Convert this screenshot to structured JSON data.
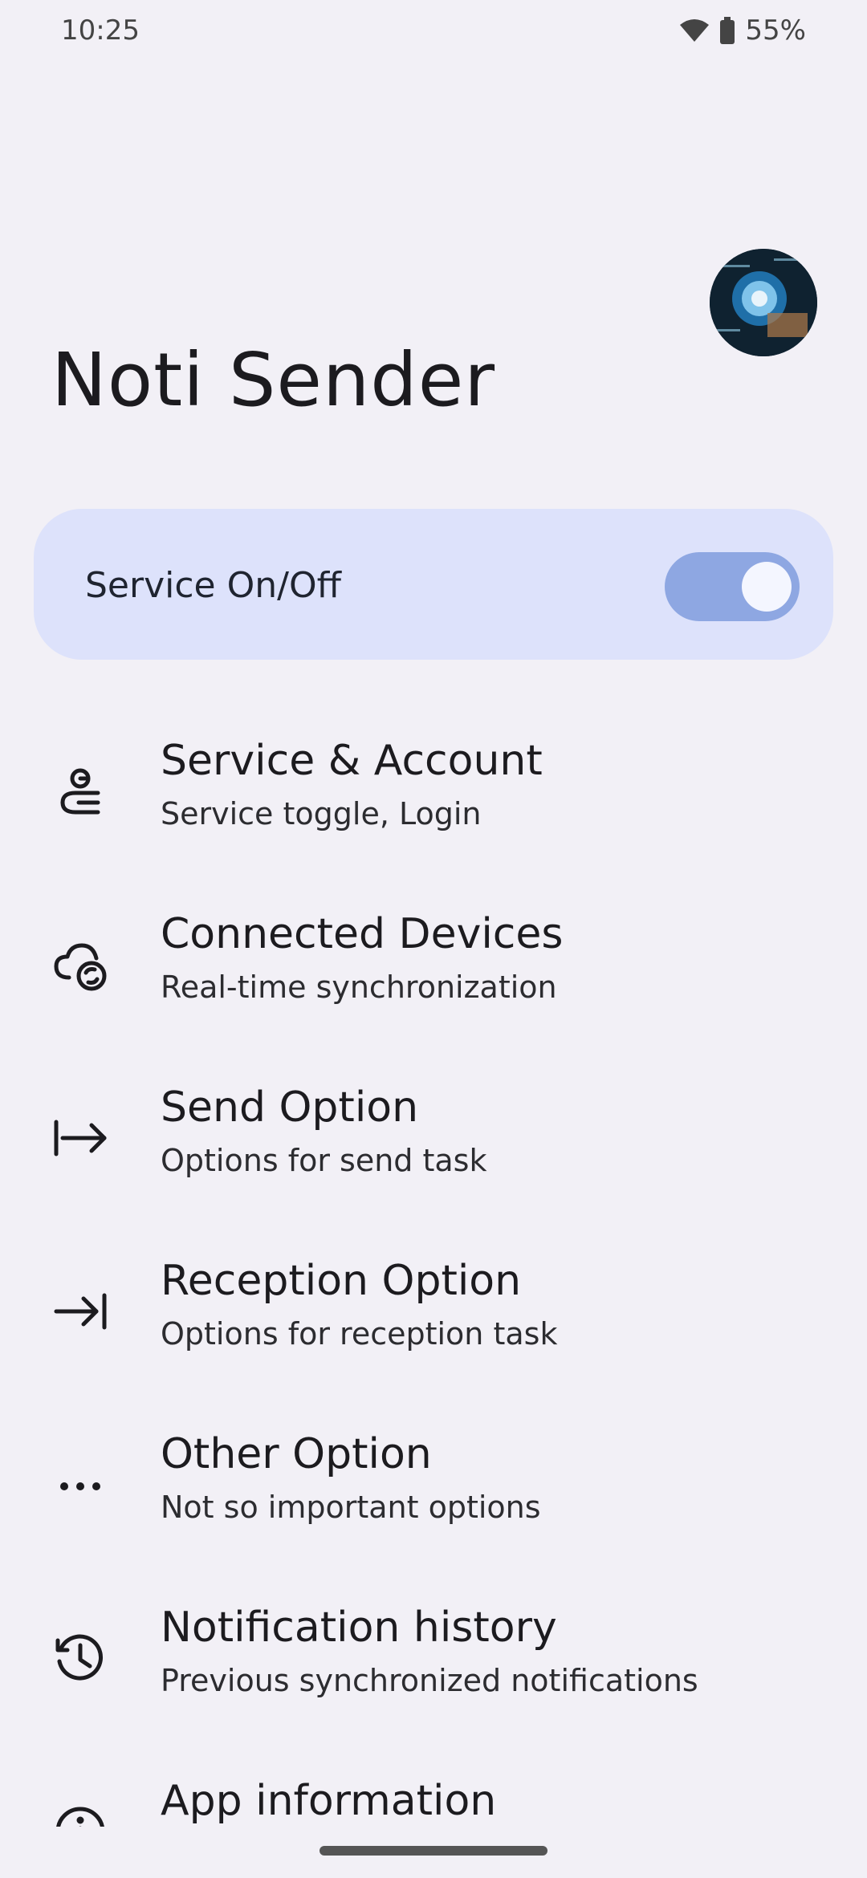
{
  "status": {
    "time": "10:25",
    "battery": "55%",
    "battery_level": 0.55
  },
  "header": {
    "title": "Noti Sender"
  },
  "service_card": {
    "label": "Service On/Off",
    "enabled": true
  },
  "menu": [
    {
      "icon": "service-account-icon",
      "title": "Service & Account",
      "subtitle": "Service toggle, Login"
    },
    {
      "icon": "cloud-sync-icon",
      "title": "Connected Devices",
      "subtitle": "Real-time synchronization"
    },
    {
      "icon": "send-arrow-icon",
      "title": "Send Option",
      "subtitle": "Options for send task"
    },
    {
      "icon": "receive-arrow-icon",
      "title": "Reception Option",
      "subtitle": "Options for reception task"
    },
    {
      "icon": "more-horiz-icon",
      "title": "Other Option",
      "subtitle": "Not so important options"
    },
    {
      "icon": "history-icon",
      "title": "Notification history",
      "subtitle": "Previous synchronized notifications"
    },
    {
      "icon": "info-icon",
      "title": "App information",
      "subtitle": ""
    }
  ],
  "colors": {
    "background": "#f2f0f6",
    "card": "#dde2fb",
    "toggle_track": "#8ea7e2",
    "toggle_thumb": "#f4f6ff"
  }
}
